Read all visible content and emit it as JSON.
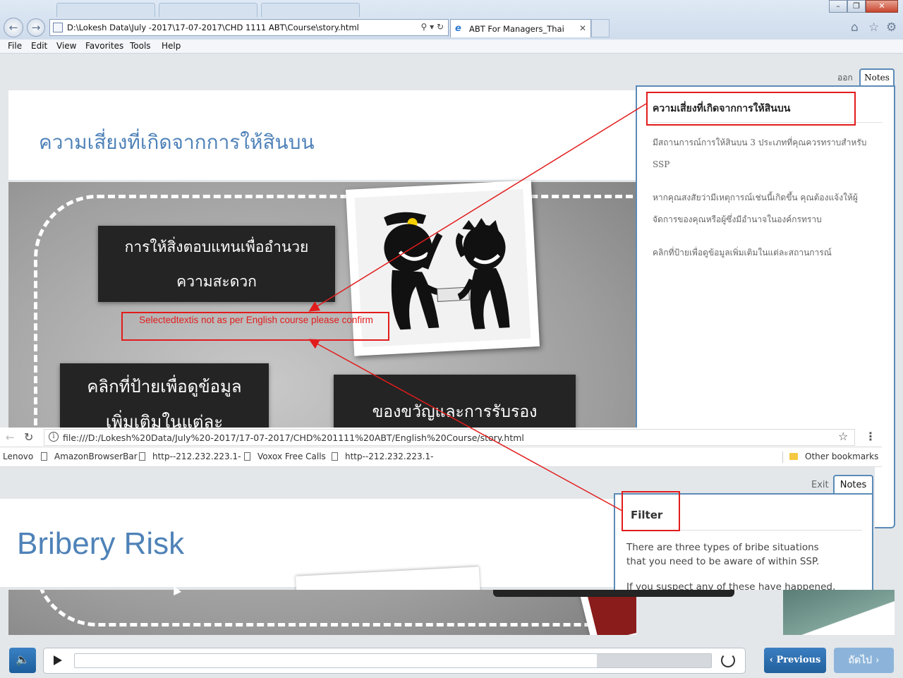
{
  "ie": {
    "address": "D:\\Lokesh Data\\July -2017\\17-07-2017\\CHD 1111 ABT\\Course\\story.html",
    "tab_title": "ABT For Managers_Thai",
    "menu": [
      "File",
      "Edit",
      "View",
      "Favorites",
      "Tools",
      "Help"
    ]
  },
  "thai": {
    "exit_label": "ออก",
    "notes_tab": "Notes",
    "slide_title": "ความเสี่ยงที่เกิดจากการให้สินบน",
    "card1": [
      "การให้สิ่งตอบแทนเพื่ออำนวย",
      "ความสะดวก"
    ],
    "card2": [
      "คลิกที่ป้ายเพื่อดูข้อมูล",
      "เพิ่มเติมในแต่ละ"
    ],
    "card3": "ของขวัญและการรับรอง",
    "notes": {
      "heading": "ความเสี่ยงที่เกิดจากการให้สินบน",
      "p1": "มีสถานการณ์การให้สินบน 3 ประเภทที่คุณควรทราบสำหรับ SSP",
      "p2": "หากคุณสงสัยว่ามีเหตุการณ์เช่นนี้เกิดขึ้น คุณต้องแจ้งให้ผู้จัดการของคุณหรือผู้ซึ่งมีอำนาจในองค์กรทราบ",
      "p3": "คลิกที่ป้ายเพื่อดูข้อมูลเพิ่มเติมในแต่ละสถานการณ์"
    }
  },
  "chrome": {
    "url": "file:///D:/Lokesh%20Data/July%20-2017/17-07-2017/CHD%201111%20ABT/English%20Course/story.html",
    "bookmarks": [
      "Lenovo",
      "AmazonBrowserBar",
      "http--212.232.223.1-",
      "Voxox Free Calls",
      "http--212.232.223.1-"
    ],
    "other_bookmarks": "Other bookmarks"
  },
  "english": {
    "exit_label": "Exit",
    "notes_tab": "Notes",
    "slide_title": "Bribery Risk",
    "notes": {
      "heading": "Filter",
      "p1": "There are three types of bribe situations that you need to be aware of within SSP.",
      "p2": "If you suspect any of these have happened,"
    }
  },
  "annotation": {
    "comment": "Selectedtextis not as per English course  please confirm",
    "color": "#e21c1c"
  },
  "player": {
    "progress": 0.82,
    "prev_label": "Previous",
    "next_label": "ถัดไป",
    "accent": "#225f9d"
  }
}
